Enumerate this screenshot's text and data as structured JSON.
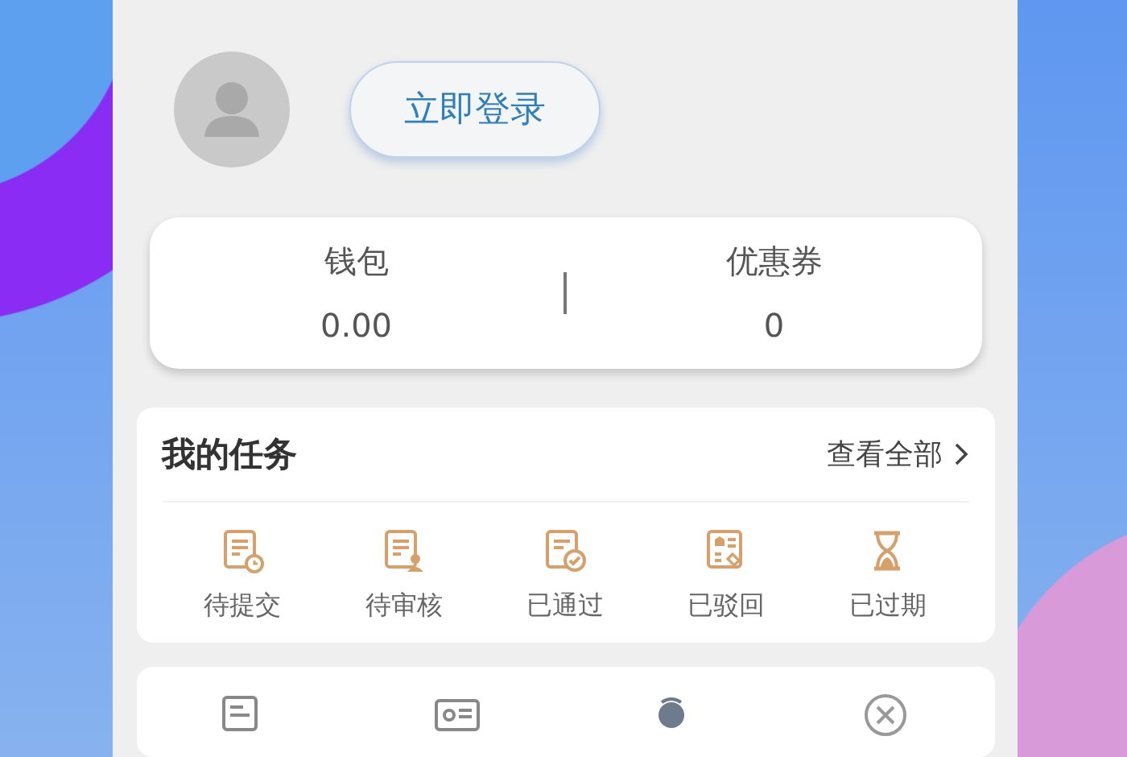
{
  "profile": {
    "login_button": "立即登录"
  },
  "wallet": [
    {
      "label": "钱包",
      "value": "0.00"
    },
    {
      "label": "优惠券",
      "value": "0"
    }
  ],
  "tasks": {
    "title": "我的任务",
    "view_all": "查看全部",
    "items": [
      {
        "label": "待提交"
      },
      {
        "label": "待审核"
      },
      {
        "label": "已通过"
      },
      {
        "label": "已驳回"
      },
      {
        "label": "已过期"
      }
    ]
  }
}
